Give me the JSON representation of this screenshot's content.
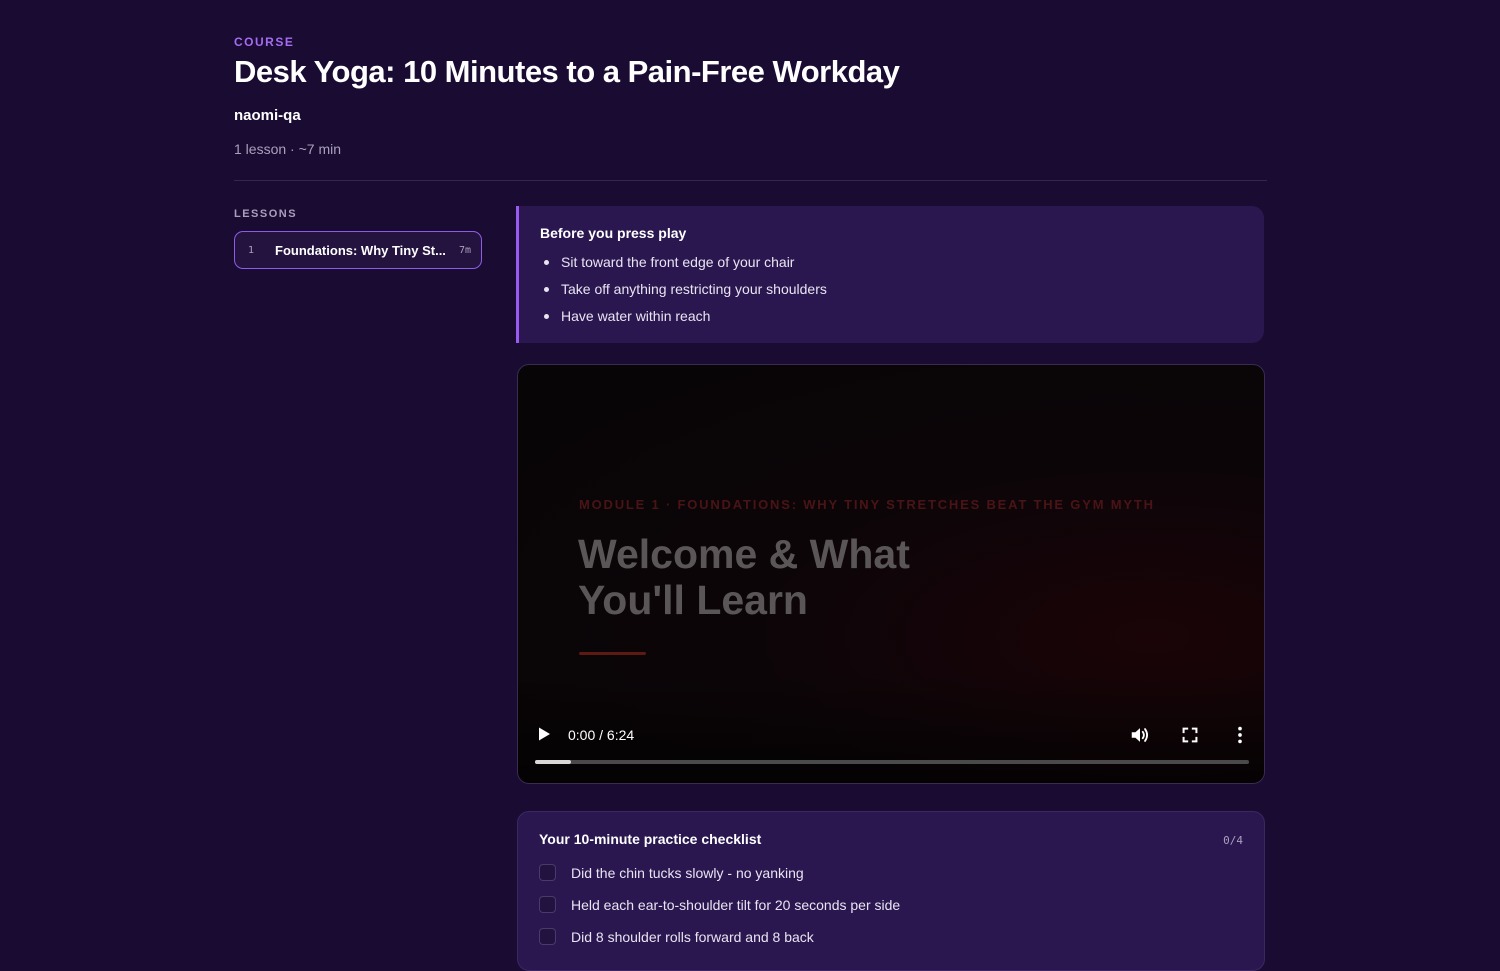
{
  "course": {
    "eyebrow": "COURSE",
    "title": "Desk Yoga: 10 Minutes to a Pain-Free Workday",
    "author": "naomi-qa",
    "meta": "1 lesson · ~7 min"
  },
  "sidebar": {
    "heading": "LESSONS",
    "lessons": [
      {
        "number": "1",
        "title": "Foundations: Why Tiny St...",
        "duration": "7m",
        "active": true
      }
    ]
  },
  "prep": {
    "title": "Before you press play",
    "items": [
      "Sit toward the front edge of your chair",
      "Take off anything restricting your shoulders",
      "Have water within reach"
    ]
  },
  "video": {
    "module_label": "MODULE 1 · FOUNDATIONS: WHY TINY STRETCHES BEAT THE GYM MYTH",
    "title": "Welcome & What You'll Learn",
    "time": "0:00 / 6:24",
    "buffered_fraction": 0.05,
    "icons": {
      "play": "play-icon",
      "volume": "volume-icon",
      "fullscreen": "fullscreen-icon",
      "more": "more-vertical-icon"
    }
  },
  "checklist": {
    "title": "Your 10-minute practice checklist",
    "count": "0/4",
    "items": [
      {
        "label": "Did the chin tucks slowly - no yanking",
        "checked": false
      },
      {
        "label": "Held each ear-to-shoulder tilt for 20 seconds per side",
        "checked": false
      },
      {
        "label": "Did 8 shoulder rolls forward and 8 back",
        "checked": false
      }
    ]
  },
  "colors": {
    "background": "#1a0b32",
    "accent": "#9a5cf0",
    "card": "#2a1750"
  }
}
